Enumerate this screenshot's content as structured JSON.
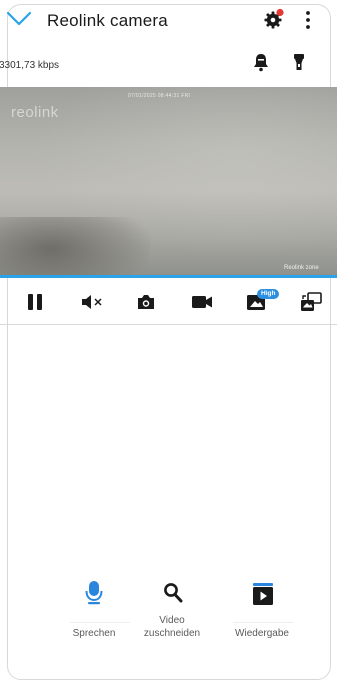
{
  "header": {
    "title": "Reolink camera"
  },
  "status": {
    "bitrate": "3301,73 kbps"
  },
  "video": {
    "logo_text": "reolink",
    "timestamp": "07/01/2025 08:44:31 FRI",
    "camera_name": "Reolink zone"
  },
  "toolbar": {
    "quality_badge": "High"
  },
  "actions": {
    "speak_label": "Sprechen",
    "clip_label_line1": "Video",
    "clip_label_line2": "zuschneiden",
    "playback_label": "Wiedergabe"
  },
  "colors": {
    "accent": "#2aa3e8",
    "notification_dot": "#e53935",
    "icon": "#1a1a1a",
    "badge": "#2d8fe0"
  }
}
